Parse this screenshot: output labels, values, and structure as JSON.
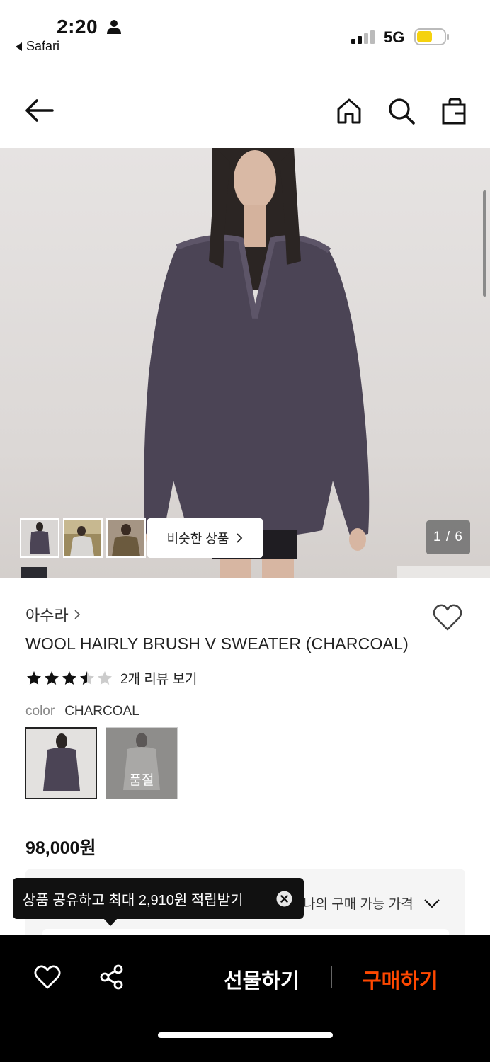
{
  "status_bar": {
    "time": "2:20",
    "back_app": "Safari",
    "network": "5G",
    "battery_color": "#f5d20f"
  },
  "nav": {
    "back_icon": "arrow-left-icon",
    "home_icon": "home-icon",
    "search_icon": "search-icon",
    "cart_icon": "shopping-bag-icon"
  },
  "gallery": {
    "similar_button": "비슷한 상품",
    "page_indicator": "1 / 6"
  },
  "product": {
    "brand": "아수라",
    "name": "WOOL HAIRLY BRUSH V SWEATER (CHARCOAL)",
    "rating": 3.5,
    "rating_max": 5,
    "review_link": "2개 리뷰 보기",
    "color_label": "color",
    "color_value": "CHARCOAL",
    "swatches": [
      {
        "name": "CHARCOAL",
        "sold_out": false
      },
      {
        "name": "",
        "sold_out": true,
        "sold_out_label": "품절"
      }
    ],
    "price": "98,000원",
    "my_price_label": "나의 구매 가능 가격"
  },
  "tooltip": {
    "text": "상품 공유하고 최대 2,910원 적립받기"
  },
  "bottom_bar": {
    "gift_label": "선물하기",
    "buy_label": "구매하기",
    "buy_color": "#ff4800"
  }
}
